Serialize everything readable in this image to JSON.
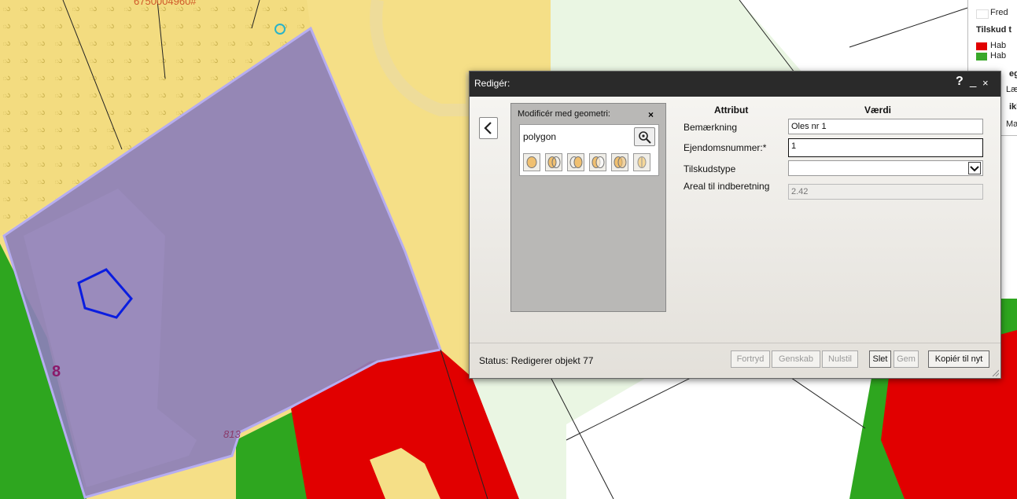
{
  "map": {
    "top_label": "6750004960#",
    "parcel_label": "8",
    "parcel_number": "813"
  },
  "legend": {
    "fred": "Fred",
    "tilskud_heading": "Tilskud t",
    "hab1": "Hab",
    "hab2": "Hab",
    "egn": "egn",
    "laeh": "Læh",
    "ikle": "ikle",
    "matr": "Matr",
    "colors": {
      "red": "#e10000",
      "green": "#3aa82a"
    }
  },
  "dialog": {
    "title": "Redigér:",
    "help": "?",
    "minimize": "_",
    "close": "×",
    "geometry_panel": {
      "header": "Modificér med geometri:",
      "close": "×",
      "select_value": "polygon"
    },
    "columns": {
      "attribute": "Attribut",
      "value": "Værdi"
    },
    "fields": [
      {
        "label": "Bemærkning",
        "value": "Oles nr 1"
      },
      {
        "label": "Ejendomsnummer:*",
        "value": "1"
      },
      {
        "label": "Tilskudstype",
        "value": ""
      },
      {
        "label": "Areal til indberetning",
        "value": "2.42"
      }
    ],
    "status": "Status: Redigerer objekt 77",
    "buttons": {
      "undo": "Fortryd",
      "redo": "Genskab",
      "reset": "Nulstil",
      "delete": "Slet",
      "save": "Gem",
      "copy": "Kopiér til nyt"
    }
  }
}
